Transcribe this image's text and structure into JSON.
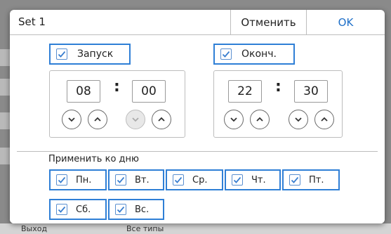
{
  "dialog": {
    "title": "Set 1",
    "cancel_label": "Отменить",
    "ok_label": "OK"
  },
  "start": {
    "label": "Запуск",
    "checked": true,
    "hour": "08",
    "minute": "00"
  },
  "end": {
    "label": "Оконч.",
    "checked": true,
    "hour": "22",
    "minute": "30"
  },
  "time_separator": ":",
  "days": {
    "heading": "Применить ко дню",
    "items": [
      {
        "label": "Пн.",
        "checked": true
      },
      {
        "label": "Вт.",
        "checked": true
      },
      {
        "label": "Ср.",
        "checked": true
      },
      {
        "label": "Чт.",
        "checked": true
      },
      {
        "label": "Пт.",
        "checked": true
      },
      {
        "label": "Сб.",
        "checked": true
      },
      {
        "label": "Вс.",
        "checked": true
      }
    ]
  },
  "background": {
    "left_text": "Выход",
    "center_text": "Все типы"
  },
  "colors": {
    "accent": "#2f7fd6",
    "ok_text": "#1e6fc8",
    "checkmark": "#3a7fd0"
  },
  "icons": {
    "check": "check-icon",
    "up": "chevron-up-icon",
    "down": "chevron-down-icon"
  }
}
